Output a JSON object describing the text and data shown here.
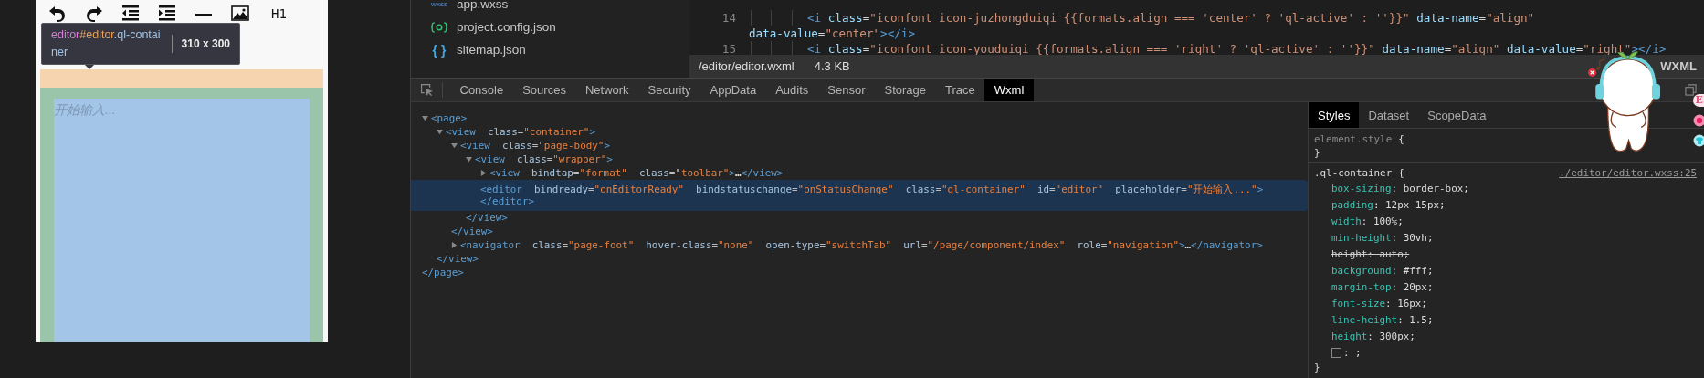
{
  "simulator": {
    "toolbar": [
      {
        "kind": "undo"
      },
      {
        "kind": "redo"
      },
      {
        "kind": "outdent"
      },
      {
        "kind": "indent"
      },
      {
        "kind": "rule"
      },
      {
        "kind": "image"
      },
      {
        "kind": "heading",
        "label": "H1"
      }
    ],
    "inspect_tooltip": {
      "tag": "editor",
      "id": "#editor",
      "class_name": ".ql-container",
      "size": "310 x 300"
    },
    "editor": {
      "placeholder": "开始输入..."
    }
  },
  "file_tree": {
    "items": [
      {
        "kind": "style",
        "icon": "wxss",
        "name": "app.wxss"
      },
      {
        "kind": "config",
        "name": "project.config.json"
      },
      {
        "kind": "json",
        "icon": "{ }",
        "name": "sitemap.json"
      }
    ]
  },
  "code_editor": {
    "lines": [
      {
        "number": "14",
        "text": "<i class=\"iconfont icon-juzhongduiqi {{formats.align === 'center' ? 'ql-active' : ''}}\" data-name=\"align\"",
        "wrap": "data-value=\"center\"></i>"
      },
      {
        "number": "15",
        "text": "<i class=\"iconfont icon-youduiqi {{formats.align === 'right' ? 'ql-active' : ''}}\" data-name=\"align\" data-value=\"right\"></i>"
      }
    ],
    "status_bar": {
      "path": "/editor/editor.wxml",
      "size": "4.3 KB",
      "language": "WXML"
    }
  },
  "devtools": {
    "tabs": [
      {
        "label": "Console",
        "selected": false
      },
      {
        "label": "Sources",
        "selected": false
      },
      {
        "label": "Network",
        "selected": false
      },
      {
        "label": "Security",
        "selected": false
      },
      {
        "label": "AppData",
        "selected": false
      },
      {
        "label": "Audits",
        "selected": false
      },
      {
        "label": "Sensor",
        "selected": false
      },
      {
        "label": "Storage",
        "selected": false
      },
      {
        "label": "Trace",
        "selected": false
      },
      {
        "label": "Wxml",
        "selected": true
      }
    ]
  },
  "wxml_tree": [
    {
      "open": "<page>",
      "close": "</page>",
      "expanded": true,
      "selected": false,
      "children": [
        {
          "open": "<view  class=\"container\">",
          "close": "</view>",
          "expanded": true,
          "selected": false,
          "children": [
            {
              "open": "<view  class=\"page-body\">",
              "close": "</view>",
              "expanded": true,
              "selected": false,
              "children": [
                {
                  "open": "<view  class=\"wrapper\">",
                  "close": "</view>",
                  "expanded": true,
                  "selected": false,
                  "children": [
                    {
                      "open": "<view  bindtap=\"format\"  class=\"toolbar\">",
                      "collapsed_mark": "…",
                      "close": "</view>",
                      "expanded": false,
                      "selected": false
                    },
                    {
                      "open": "<editor  bindready=\"onEditorReady\"  bindstatuschange=\"onStatusChange\"  class=\"ql-container\"  id=\"editor\"  placeholder=\"开始输入...\">",
                      "close": "</editor>",
                      "selected": true
                    }
                  ]
                }
              ]
            },
            {
              "open": "<navigator  class=\"page-foot\"  hover-class=\"none\"  open-type=\"switchTab\"  url=\"/page/component/index\"  role=\"navigation\">",
              "collapsed_mark": "…",
              "close": "</navigator>",
              "expanded": false,
              "selected": false
            }
          ]
        }
      ]
    }
  ],
  "styles_panel": {
    "tabs": [
      {
        "label": "Styles",
        "selected": true
      },
      {
        "label": "Dataset",
        "selected": false
      },
      {
        "label": "ScopeData",
        "selected": false
      }
    ],
    "element_style": {
      "selector": "element.style",
      "open": "{",
      "close": "}"
    },
    "rules": [
      {
        "selector": ".ql-container",
        "open": "{",
        "source": "./editor/editor.wxss:25",
        "properties": [
          {
            "kind": "property",
            "text": "box-sizing: border-box;",
            "overridden": false
          },
          {
            "kind": "property",
            "text": "padding: 12px 15px;",
            "overridden": false
          },
          {
            "kind": "property",
            "text": "width: 100%;",
            "overridden": false
          },
          {
            "kind": "property",
            "text": "min-height: 30vh;",
            "overridden": false
          },
          {
            "kind": "property",
            "text": "height: auto;",
            "overridden": true
          },
          {
            "kind": "property",
            "text": "background: #fff;",
            "overridden": false
          },
          {
            "kind": "property",
            "text": "margin-top: 20px;",
            "overridden": false
          },
          {
            "kind": "property",
            "text": "font-size: 16px;",
            "overridden": false
          },
          {
            "kind": "property",
            "text": "line-height: 1.5;",
            "overridden": false
          },
          {
            "kind": "property",
            "text": "height: 300px;",
            "overridden": false
          },
          {
            "kind": "new",
            "text": ": ;",
            "checked": false
          }
        ],
        "close": "}"
      }
    ]
  },
  "desktop_pet": {
    "badge": "E"
  }
}
